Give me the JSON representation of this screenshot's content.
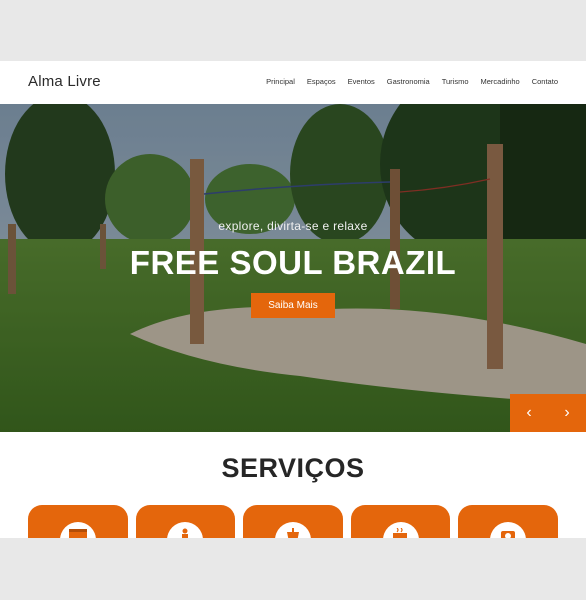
{
  "header": {
    "brand": "Alma Livre",
    "nav": [
      {
        "label": "Principal"
      },
      {
        "label": "Espaços"
      },
      {
        "label": "Eventos"
      },
      {
        "label": "Gastronomia"
      },
      {
        "label": "Turismo"
      },
      {
        "label": "Mercadinho"
      },
      {
        "label": "Contato"
      }
    ]
  },
  "hero": {
    "subtitle": "explore, divirta-se e relaxe",
    "title": "FREE SOUL BRAZIL",
    "button_label": "Saiba Mais",
    "prev_icon": "‹",
    "next_icon": "›"
  },
  "services": {
    "title": "SERVIÇOS",
    "cards": [
      {
        "icon": "calendar-icon"
      },
      {
        "icon": "person-icon"
      },
      {
        "icon": "drink-icon"
      },
      {
        "icon": "coffee-icon"
      },
      {
        "icon": "camera-icon"
      }
    ]
  },
  "colors": {
    "accent": "#e4660c",
    "background": "#e8e8e8"
  }
}
